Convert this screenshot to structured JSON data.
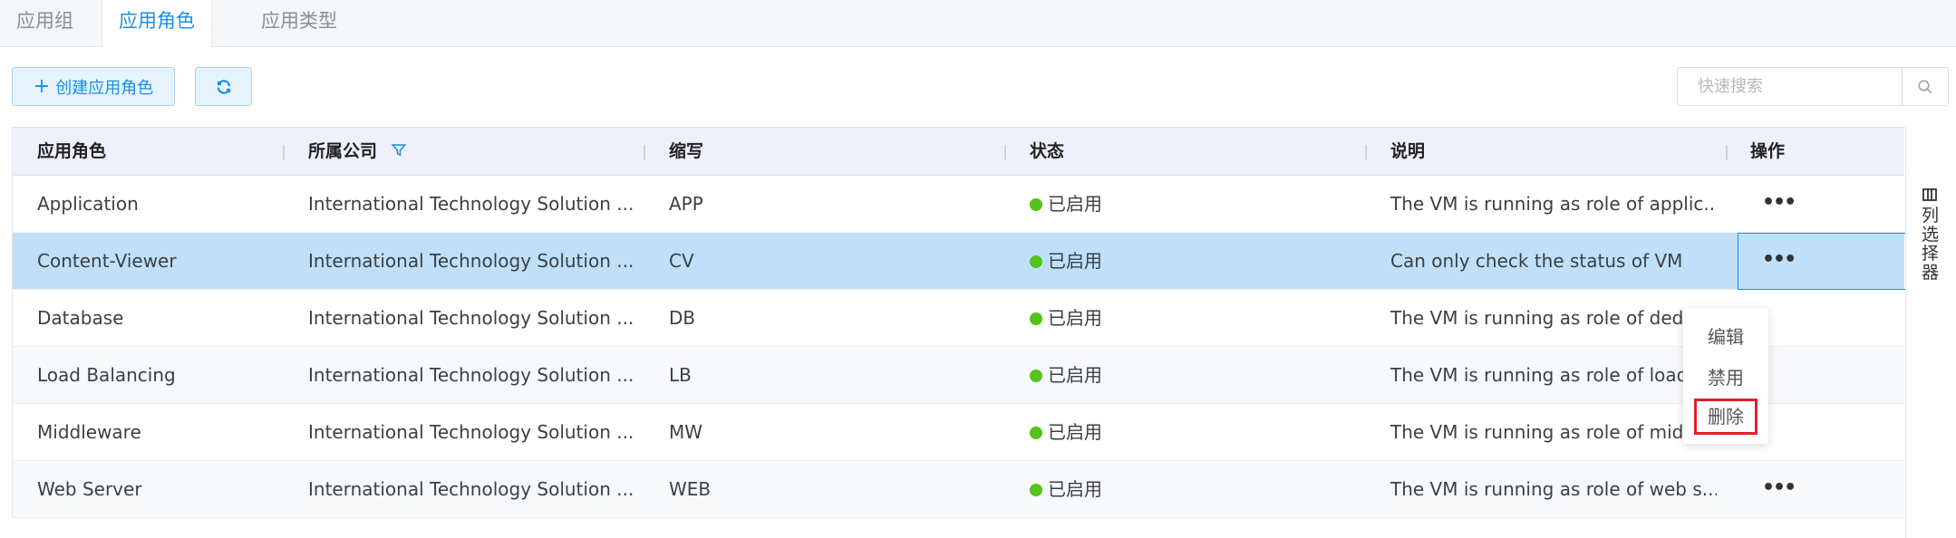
{
  "tabs": [
    {
      "label": "应用组"
    },
    {
      "label": "应用角色"
    },
    {
      "label": "应用类型"
    }
  ],
  "toolbar": {
    "create_label": "创建应用角色",
    "search_placeholder": "快速搜索"
  },
  "table": {
    "columns": [
      "应用角色",
      "所属公司",
      "缩写",
      "状态",
      "说明",
      "操作"
    ],
    "rows": [
      {
        "role": "Application",
        "company": "International Technology Solution ...",
        "abbr": "APP",
        "status": "已启用",
        "desc": "The VM is running as role of applic..."
      },
      {
        "role": "Content-Viewer",
        "company": "International Technology Solution ...",
        "abbr": "CV",
        "status": "已启用",
        "desc": "Can only check the status of VM"
      },
      {
        "role": "Database",
        "company": "International Technology Solution ...",
        "abbr": "DB",
        "status": "已启用",
        "desc": "The VM is running as role of dedica"
      },
      {
        "role": "Load Balancing",
        "company": "International Technology Solution ...",
        "abbr": "LB",
        "status": "已启用",
        "desc": "The VM is running as role of load b"
      },
      {
        "role": "Middleware",
        "company": "International Technology Solution ...",
        "abbr": "MW",
        "status": "已启用",
        "desc": "The VM is running as role of middl..."
      },
      {
        "role": "Web Server",
        "company": "International Technology Solution ...",
        "abbr": "WEB",
        "status": "已启用",
        "desc": "The VM is running as role of web s..."
      }
    ],
    "ops_glyph": "•••"
  },
  "dropdown": {
    "edit": "编辑",
    "disable": "禁用",
    "delete": "删除"
  },
  "column_selector": {
    "label": "列选择器"
  },
  "colors": {
    "accent": "#1a8fe3",
    "status_enabled": "#52c41a",
    "selected_row": "#bfe0f8",
    "delete_highlight": "#e0202d"
  }
}
